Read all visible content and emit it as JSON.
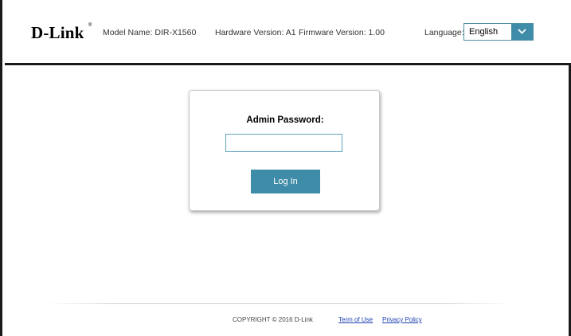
{
  "header": {
    "brand": "D-Link",
    "registered_mark": "®",
    "model_name": "Model Name: DIR-X1560",
    "hardware_version": "Hardware Version: A1",
    "firmware_version": "Firmware Version: 1.00",
    "language_label": "Language:",
    "language_selected": "English",
    "dropdown_icon": "chevron-down-icon"
  },
  "login": {
    "password_label": "Admin Password:",
    "password_value": "",
    "password_placeholder": "",
    "login_button": "Log In"
  },
  "footer": {
    "copyright": "COPYRIGHT © 2016 D-Link",
    "terms_link": "Term of Use",
    "privacy_link": "Privacy Policy"
  },
  "colors": {
    "accent": "#3f8ca8",
    "frame": "#1a1a1a",
    "link": "#1a3fb0"
  }
}
